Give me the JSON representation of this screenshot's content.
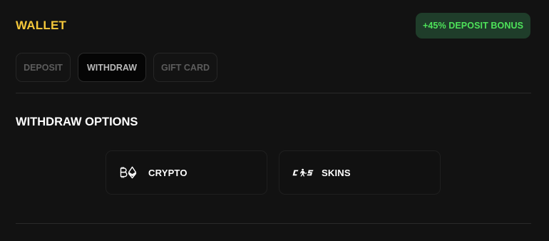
{
  "header": {
    "title": "WALLET",
    "bonus_badge": "+45% DEPOSIT BONUS"
  },
  "tabs": [
    {
      "label": "DEPOSIT",
      "active": false
    },
    {
      "label": "WITHDRAW",
      "active": true
    },
    {
      "label": "GIFT CARD",
      "active": false
    }
  ],
  "withdraw": {
    "section_title": "WITHDRAW OPTIONS",
    "options": [
      {
        "label": "CRYPTO",
        "icon": "crypto-icon"
      },
      {
        "label": "SKINS",
        "icon": "cs-icon"
      }
    ]
  },
  "colors": {
    "background": "#121212",
    "accent_yellow": "#f5c83a",
    "bonus_green": "#4ee35a",
    "bonus_bg": "#1f3d2a"
  }
}
